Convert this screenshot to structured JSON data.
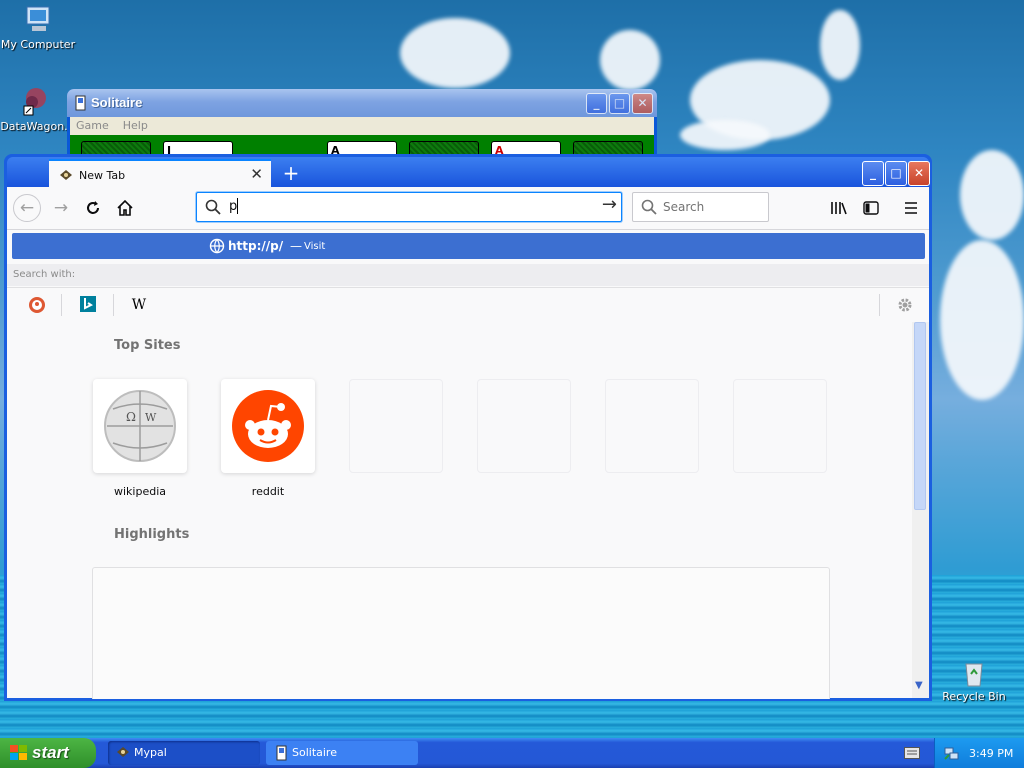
{
  "desktop": {
    "icons": [
      {
        "label": "My Computer"
      },
      {
        "label": "DataWagon."
      },
      {
        "label": "Recycle Bin"
      }
    ]
  },
  "solitaire": {
    "title": "Solitaire",
    "menu": [
      "Game",
      "Help"
    ]
  },
  "browser": {
    "tab": {
      "title": "New Tab",
      "close": "✕"
    },
    "new_tab": "+",
    "url": {
      "value": "p"
    },
    "search": {
      "placeholder": "Search"
    },
    "autocomplete": {
      "url": "http://p/",
      "dash": "—",
      "action": "Visit"
    },
    "search_with": "Search with:",
    "engines": [
      {
        "name": "DuckDuckGo"
      },
      {
        "name": "Bing"
      },
      {
        "name": "Wikipedia",
        "glyph": "W"
      }
    ],
    "top_sites_title": "Top Sites",
    "top_sites": [
      {
        "label": "wikipedia"
      },
      {
        "label": "reddit"
      },
      {
        "label": ""
      },
      {
        "label": ""
      },
      {
        "label": ""
      },
      {
        "label": ""
      }
    ],
    "highlights_title": "Highlights"
  },
  "taskbar": {
    "start": "start",
    "buttons": [
      {
        "label": "Mypal"
      },
      {
        "label": "Solitaire"
      }
    ],
    "clock": "3:49 PM"
  },
  "colors": {
    "accent": "#0a84ff",
    "reddit": "#ff4500",
    "autocomplete_bg": "#3c6fd1"
  }
}
